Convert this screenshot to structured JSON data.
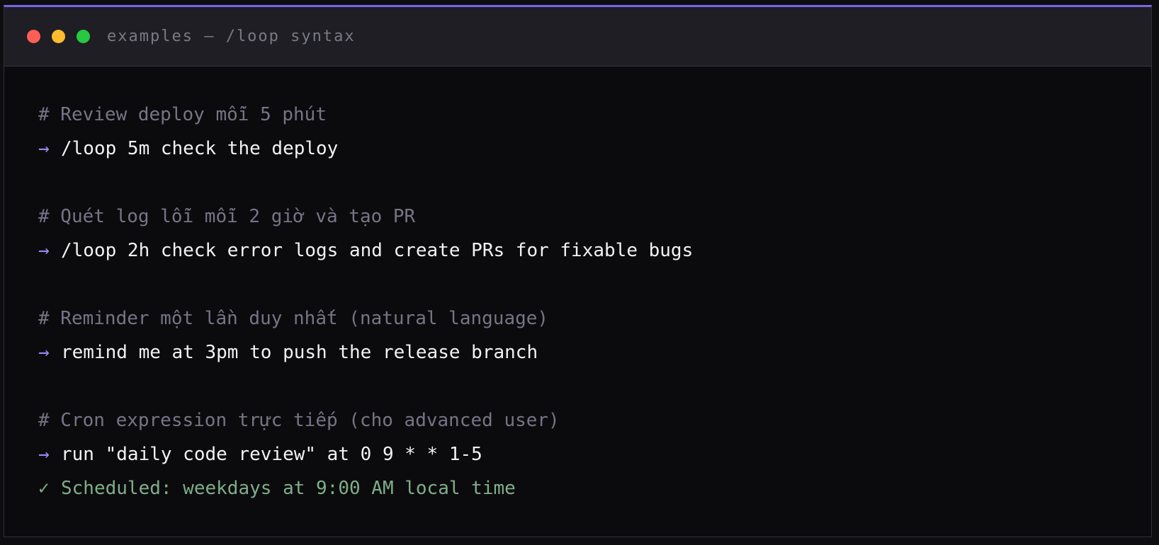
{
  "window": {
    "title": "examples — /loop syntax",
    "controls": [
      {
        "name": "close-button",
        "color": "#ff5f57"
      },
      {
        "name": "minimize-button",
        "color": "#febc2e"
      },
      {
        "name": "maximize-button",
        "color": "#28c840"
      }
    ],
    "accent_color": "#7b63e6"
  },
  "terminal": {
    "arrow_symbol": "→",
    "check_symbol": "✓",
    "blocks": [
      {
        "comment": "# Review deploy mỗi 5 phút",
        "command": "/loop 5m check the deploy"
      },
      {
        "comment": "# Quét log lỗi mỗi 2 giờ và tạo PR",
        "command": "/loop 2h check error logs and create PRs for fixable bugs"
      },
      {
        "comment": "# Reminder một lần duy nhất (natural language)",
        "command": "remind me at 3pm to push the release branch"
      },
      {
        "comment": "# Cron expression trực tiếp (cho advanced user)",
        "command": "run \"daily code review\" at 0 9 * * 1-5",
        "result": "Scheduled: weekdays at 9:00 AM local time"
      }
    ]
  }
}
